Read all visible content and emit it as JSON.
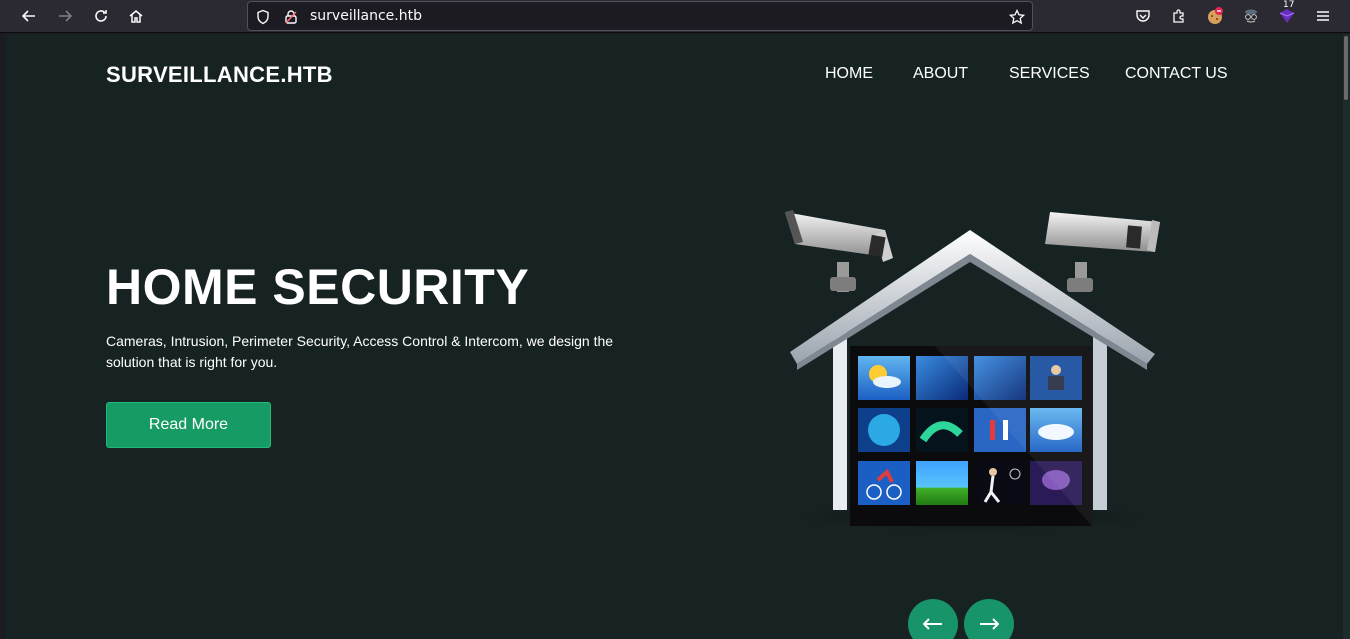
{
  "browser": {
    "url": "surveillance.htb",
    "extension_badge_count": "17",
    "icons": {
      "back": "back-arrow-icon",
      "forward": "forward-arrow-icon",
      "reload": "reload-icon",
      "home": "home-icon",
      "shield": "tracking-protection-shield-icon",
      "lock": "insecure-lock-icon",
      "bookmark": "bookmark-star-icon",
      "pocket": "pocket-icon",
      "extensions": "extensions-puzzle-icon",
      "menu": "hamburger-menu-icon"
    }
  },
  "site": {
    "brand": "SURVEILLANCE.HTB",
    "nav": [
      "HOME",
      "ABOUT",
      "SERVICES",
      "CONTACT US"
    ],
    "hero": {
      "title": "HOME SECURITY",
      "description": "Cameras, Intrusion, Perimeter Security, Access Control & Intercom, we design the solution that is right for you.",
      "button_label": "Read More"
    },
    "carousel": {
      "prev_icon": "left-arrow-icon",
      "next_icon": "right-arrow-icon"
    }
  },
  "colors": {
    "page_background": "#172323",
    "accent_green": "#179b65",
    "text": "#ffffff"
  }
}
